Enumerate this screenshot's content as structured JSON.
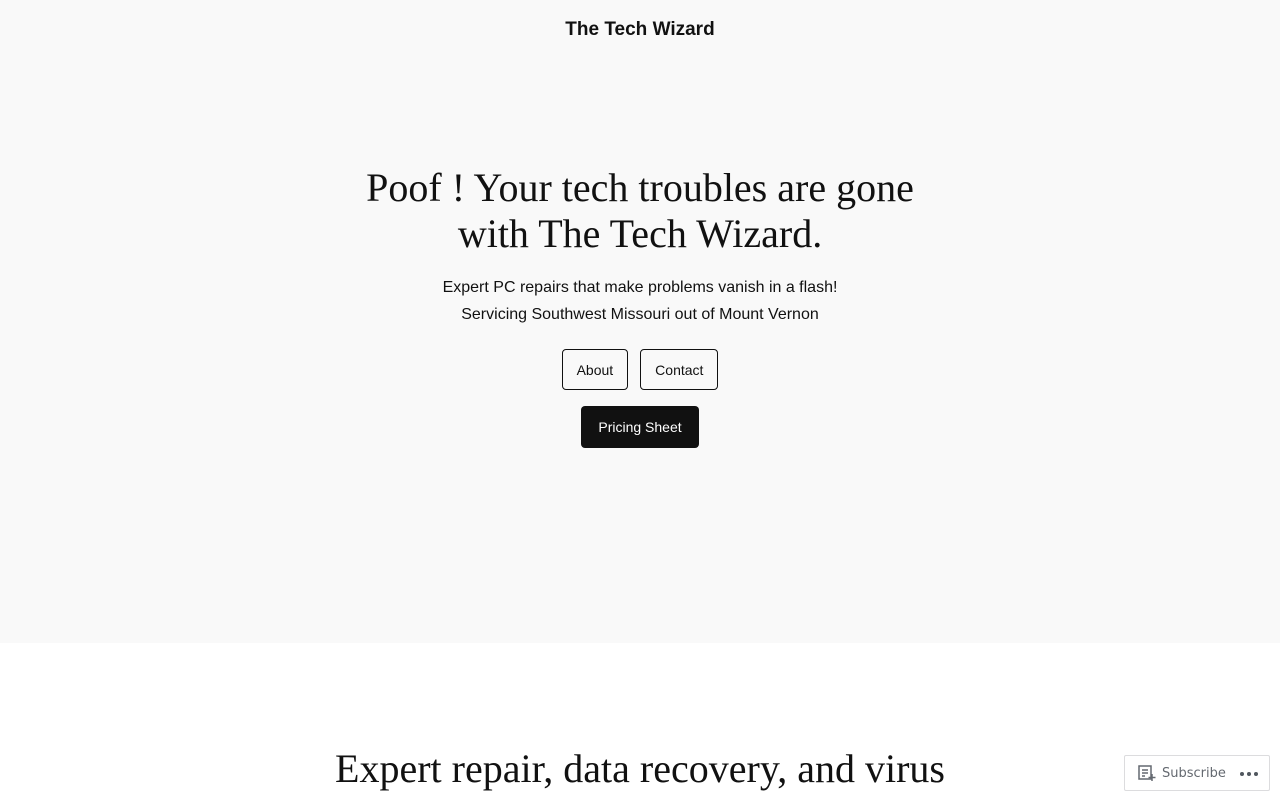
{
  "site": {
    "title": "The Tech Wizard"
  },
  "hero": {
    "headline": "Poof ! Your tech troubles are gone with The Tech Wizard.",
    "subtitle_line1": "Expert PC repairs that make problems vanish in a flash!",
    "subtitle_line2": "Servicing Southwest Missouri out of Mount Vernon",
    "buttons": [
      {
        "label": "About"
      },
      {
        "label": "Contact"
      }
    ],
    "primary_button": {
      "label": "Pricing Sheet"
    }
  },
  "section2": {
    "heading": "Expert repair, data recovery, and virus"
  },
  "action_bar": {
    "subscribe_label": "Subscribe",
    "subscribe_icon": "reader-subscribe-icon",
    "more_icon": "ellipsis-icon"
  },
  "colors": {
    "hero_background": "#f9f9f9",
    "page_background": "#ffffff",
    "text": "#111111",
    "primary_button_bg": "#111111",
    "primary_button_text": "#ffffff"
  }
}
